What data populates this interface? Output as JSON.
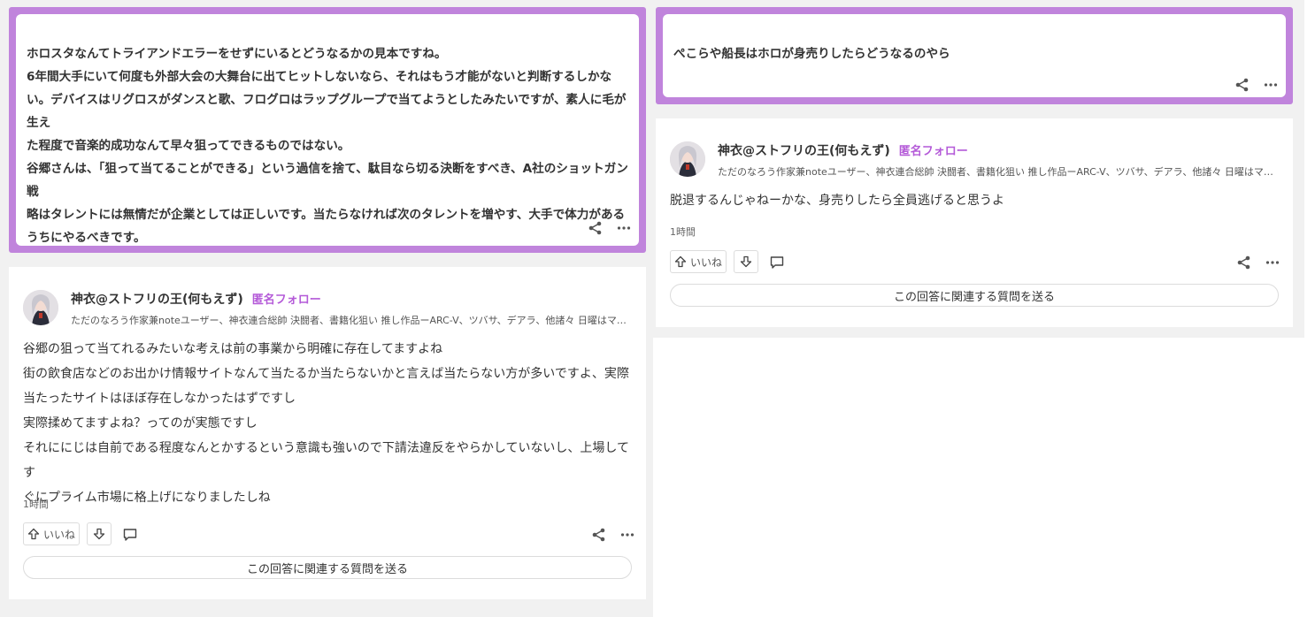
{
  "left": {
    "quote": {
      "lines": [
        "ホロスタなんてトライアンドエラーをせずにいるとどうなるかの見本ですね。",
        "6年間大手にいて何度も外部大会の大舞台に出てヒットしないなら、それはもう才能がないと判断するしかな",
        "い。デバイスはリグロスがダンスと歌、フログロはラップグループで当てようとしたみたいですが、素人に毛が生え",
        "た程度で音楽的成功なんて早々狙ってできるものではない。",
        "谷郷さんは、「狙って当てることができる」という過信を捨て、駄目なら切る決断をすべき、A社のショットガン戦",
        "略はタレントには無情だが企業としては正しいです。当たらなければ次のタレントを増やす、大手で体力がある",
        "うちにやるべきです。"
      ]
    },
    "answer": {
      "author_name": "神衣@ストフリの王(何もえず)",
      "follow_label": "匿名フォロー",
      "bio": "ただのなろう作家兼noteユーザー、神衣連合総帥 決闘者、書籍化狙い 推し作品ーARC-V、ツバサ、デアラ、他諸々 日曜はマホメモ...",
      "lines": [
        "谷郷の狙って当てれるみたいな考えは前の事業から明確に存在してますよね",
        "街の飲食店などのお出かけ情報サイトなんて当たるか当たらないかと言えば当たらない方が多いですよ、実際",
        "当たったサイトはほぼ存在しなかったはずですし",
        "実際揉めてますよね？ってのが実態ですし",
        "それににじは自前である程度なんとかするという意識も強いので下請法違反をやらかしていないし、上場してす",
        "ぐにプライム市場に格上げになりましたしね"
      ],
      "time": "1時間",
      "like_label": "いいね",
      "send_question_label": "この回答に関連する質問を送る"
    }
  },
  "right": {
    "quote": {
      "lines": [
        "ぺこらや船長はホロが身売りしたらどうなるのやら"
      ]
    },
    "answer": {
      "author_name": "神衣@ストフリの王(何もえず)",
      "follow_label": "匿名フォロー",
      "bio": "ただのなろう作家兼noteユーザー、神衣連合総帥 決闘者、書籍化狙い 推し作品ーARC-V、ツバサ、デアラ、他諸々 日曜はマホメモ...",
      "lines": [
        "脱退するんじゃねーかな、身売りしたら全員逃げると思うよ"
      ],
      "time": "1時間",
      "like_label": "いいね",
      "send_question_label": "この回答に関連する質問を送る"
    }
  },
  "colors": {
    "accent": "#c084dc",
    "follow": "#b45ad8"
  },
  "icons": [
    "share-icon",
    "more-icon",
    "upvote-icon",
    "downvote-icon",
    "comment-icon"
  ]
}
